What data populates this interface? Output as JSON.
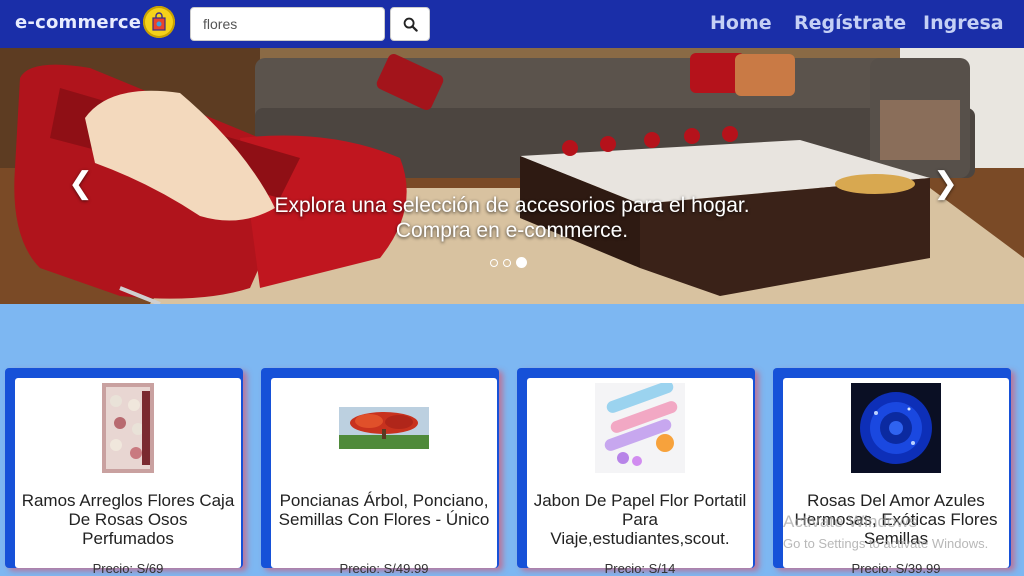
{
  "navbar": {
    "brand": "e-commerce",
    "logo_icon": "shopping-bag-icon",
    "search": {
      "value": "flores",
      "button_icon": "search-icon"
    },
    "links": [
      "Home",
      "Regístrate",
      "Ingresa"
    ]
  },
  "carousel": {
    "caption_line1": "Explora una selección de accesorios para el hogar.",
    "caption_line2": "Compra en e-commerce.",
    "prev_icon": "chevron-left-icon",
    "next_icon": "chevron-right-icon",
    "slide_count": 3,
    "active_slide": 3
  },
  "products": [
    {
      "title": "Ramos Arreglos Flores Caja De Rosas Osos Perfumados",
      "price": "Precio: S/69",
      "image_icon": "gift-box-image"
    },
    {
      "title": "Poncianas Árbol, Ponciano, Semillas Con Flores - Único",
      "price": "Precio: S/49.99",
      "image_icon": "tree-image"
    },
    {
      "title": "Jabon De Papel Flor Portatil Para Viaje,estudiantes,scout.",
      "price": "Precio: S/14",
      "image_icon": "soap-tubes-image"
    },
    {
      "title": "Rosas Del Amor Azules Hermosas, Exóticas Flores Semillas",
      "price": "Precio: S/39.99",
      "image_icon": "blue-rose-image"
    }
  ],
  "watermark": {
    "line1": "Activate Windows",
    "line2": "Go to Settings to activate Windows."
  },
  "colors": {
    "navbar": "#1a2ea8",
    "page_background": "#7db7f2",
    "card_frame": "#1651d8"
  }
}
